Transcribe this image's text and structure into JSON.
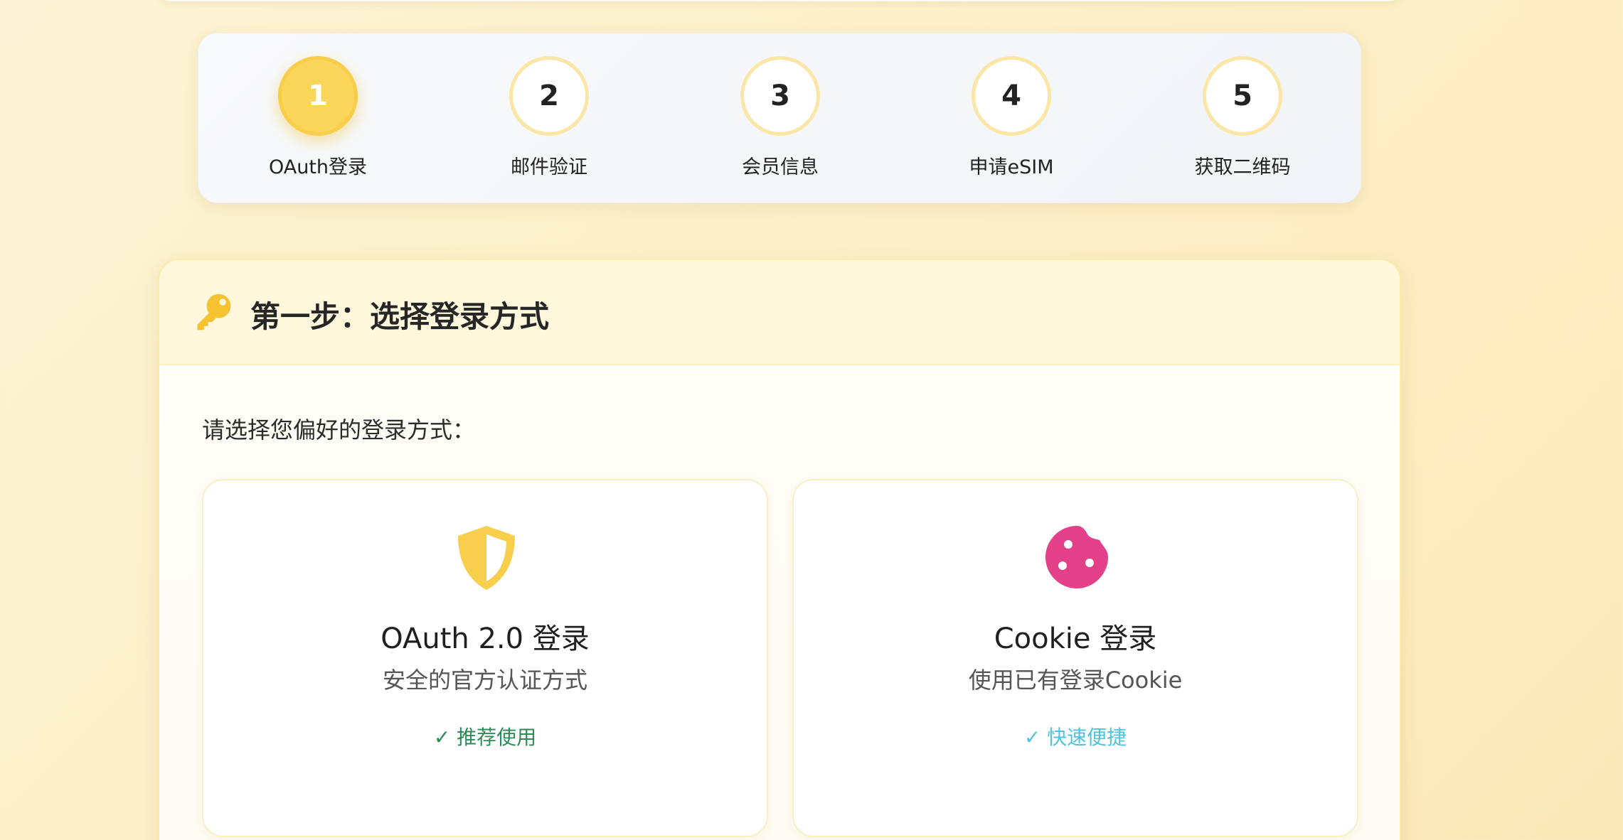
{
  "stepper": {
    "steps": [
      {
        "number": "1",
        "label": "OAuth登录",
        "active": true
      },
      {
        "number": "2",
        "label": "邮件验证",
        "active": false
      },
      {
        "number": "3",
        "label": "会员信息",
        "active": false
      },
      {
        "number": "4",
        "label": "申请eSIM",
        "active": false
      },
      {
        "number": "5",
        "label": "获取二维码",
        "active": false
      }
    ]
  },
  "card": {
    "icon": "key-icon",
    "title": "第一步：选择登录方式",
    "prompt": "请选择您偏好的登录方式：",
    "options": [
      {
        "icon": "shield-icon",
        "title": "OAuth 2.0 登录",
        "description": "安全的官方认证方式",
        "badge": "✓ 推荐使用",
        "badge_color": "#2e8b57"
      },
      {
        "icon": "cookie-icon",
        "title": "Cookie 登录",
        "description": "使用已有登录Cookie",
        "badge": "✓ 快速便捷",
        "badge_color": "#4fc3e0"
      }
    ]
  },
  "colors": {
    "accent": "#f9d55a",
    "shield": "#f7cf4d",
    "cookie": "#e4408a",
    "key": "#f5c330"
  }
}
